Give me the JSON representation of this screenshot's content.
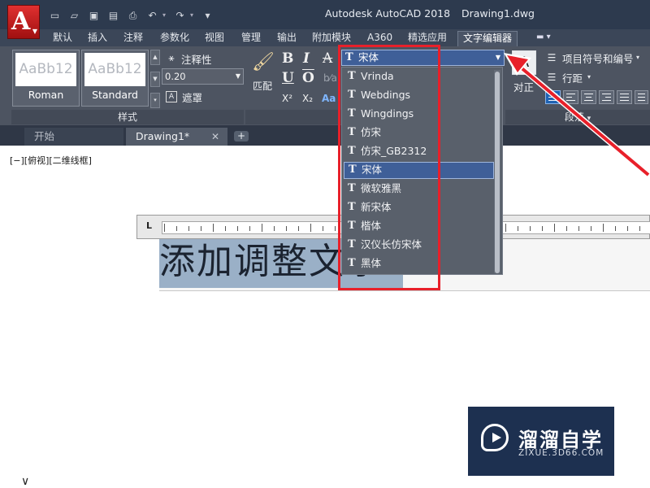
{
  "app": {
    "logo_letter": "A",
    "title": "Autodesk AutoCAD 2018",
    "file": "Drawing1.dwg"
  },
  "quick_access": {
    "icons": [
      "new-icon",
      "open-icon",
      "save-icon",
      "save-as-icon",
      "print-icon",
      "undo-icon",
      "redo-icon",
      "dropdown-icon"
    ]
  },
  "ribbon_tabs": [
    {
      "label": "默认"
    },
    {
      "label": "插入"
    },
    {
      "label": "注释"
    },
    {
      "label": "参数化"
    },
    {
      "label": "视图"
    },
    {
      "label": "管理"
    },
    {
      "label": "输出"
    },
    {
      "label": "附加模块"
    },
    {
      "label": "A360"
    },
    {
      "label": "精选应用"
    },
    {
      "label": "文字编辑器",
      "active": true
    }
  ],
  "ribbon": {
    "styles": [
      {
        "preview": "AaBb12",
        "name": "Roman"
      },
      {
        "preview": "AaBb12",
        "name": "Standard"
      }
    ],
    "annotative_label": "注释性",
    "text_height": "0.20",
    "mask_label": "遮罩",
    "style_panel_title": "样式",
    "match_label": "匹配",
    "format_buttons": [
      "B",
      "I",
      "A",
      "U",
      "O",
      "X²",
      "X₂",
      "Aa"
    ],
    "font_current": "宋体",
    "justify_label": "对正",
    "bullets_label": "项目符号和编号",
    "line_spacing_label": "行距",
    "paragraph_panel_title": "段落"
  },
  "font_dropdown": {
    "items": [
      "Vrinda",
      "Webdings",
      "Wingdings",
      "仿宋",
      "仿宋_GB2312",
      "宋体",
      "微软雅黑",
      "新宋体",
      "楷体",
      "汉仪长仿宋体",
      "黑体"
    ],
    "selected": "宋体"
  },
  "doc_tabs": [
    {
      "label": "开始"
    },
    {
      "label": "Drawing1*",
      "active": true
    }
  ],
  "add_tab_label": "+",
  "viewport_label": "[−][俯视][二维线框]",
  "ruler_mark": "L",
  "editor_text": "添加调整文字",
  "watermark": {
    "title": "溜溜自学",
    "subtitle": "ZIXUE.3D66.COM"
  },
  "colors": {
    "highlight": "#e8202a",
    "selection": "#3f5f98",
    "titlebar": "#2d3a4e",
    "ribbon": "#4d5461"
  }
}
